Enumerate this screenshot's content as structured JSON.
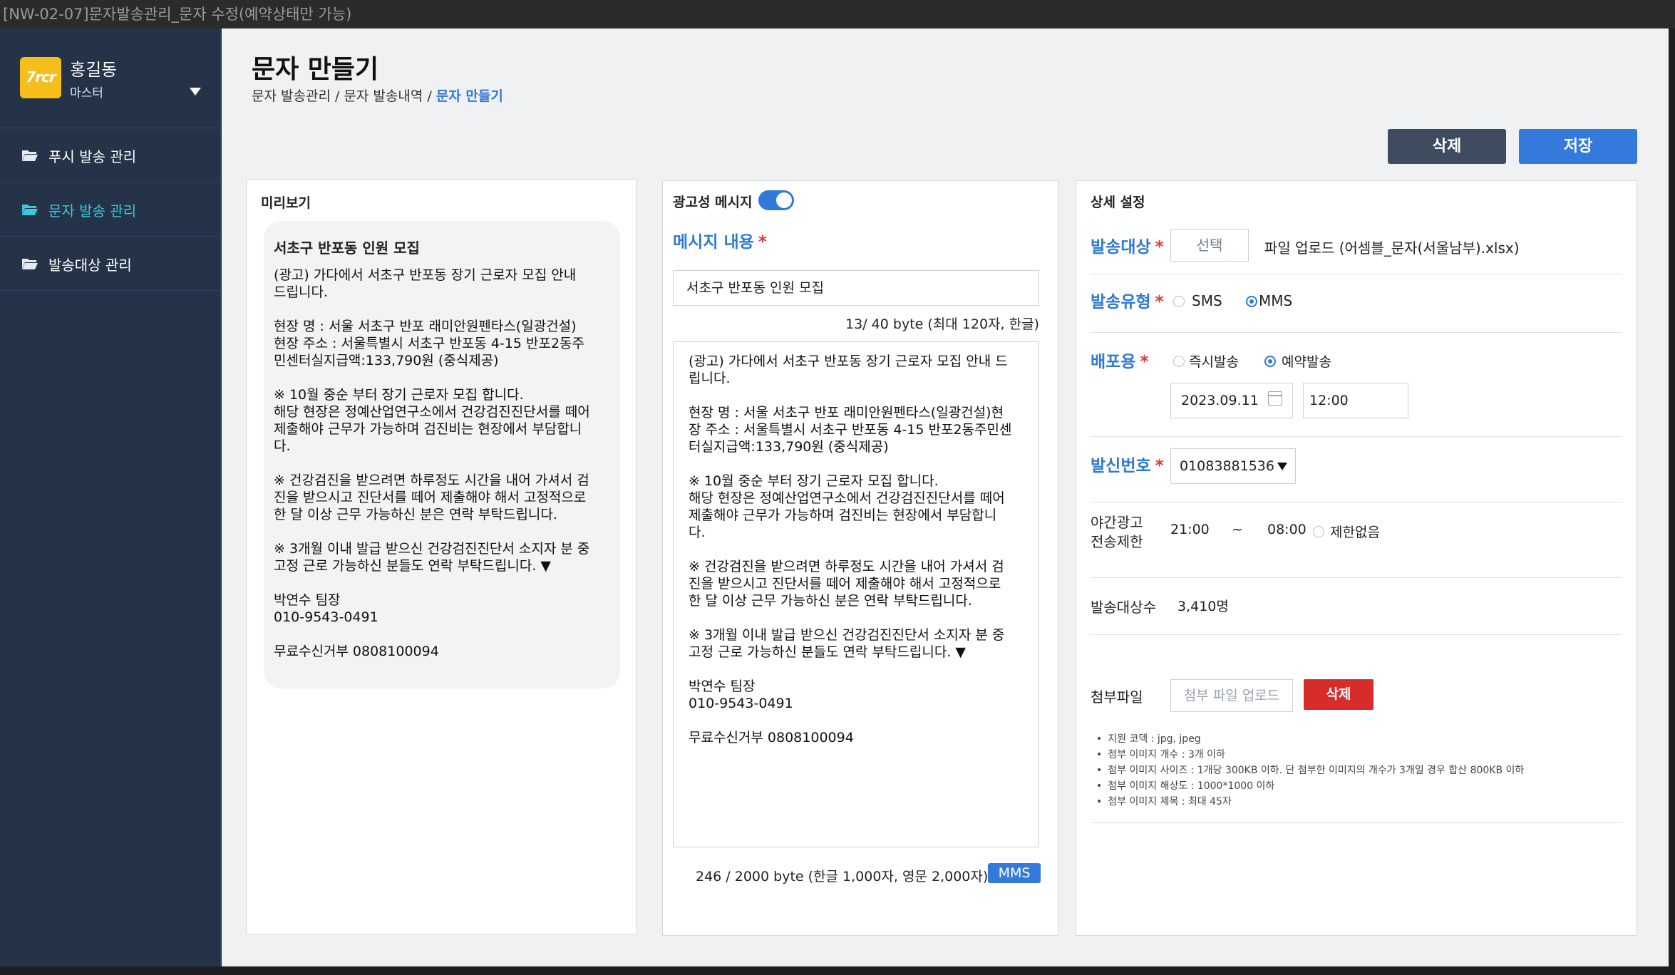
{
  "window": {
    "title": "[NW-02-07]문자발송관리_문자 수정(예약상태만 가능)"
  },
  "sidebar": {
    "logo_text": "7rcr",
    "user_name": "홍길동",
    "user_role": "마스터",
    "items": [
      {
        "label": "푸시 발송 관리",
        "active": false
      },
      {
        "label": "문자 발송 관리",
        "active": true
      },
      {
        "label": "발송대상 관리",
        "active": false
      }
    ]
  },
  "header": {
    "title": "문자 만들기",
    "breadcrumb": [
      "문자 발송관리",
      "문자 발송내역",
      "문자 만들기"
    ],
    "separator": " / "
  },
  "toolbar": {
    "delete_label": "삭제",
    "save_label": "저장"
  },
  "preview": {
    "title": "미리보기",
    "message_title": "서초구 반포동 인원 모집",
    "message_body": "(광고) 가다에서 서초구 반포동 장기 근로자 모집 안내\n드립니다.\n\n현장 명 : 서울 서초구 반포 래미안원펜타스(일광건설)\n현장 주소 : 서울특별시 서초구 반포동 4-15 반포2동주\n민센터실지급액:133,790원 (중식제공)\n\n※ 10월 중순 부터 장기 근로자 모집 합니다.\n해당 현장은 정예산업연구소에서 건강검진진단서를 떼어\n제출해야 근무가 가능하며 검진비는 현장에서 부담합니\n다.\n\n※ 건강검진을 받으려면 하루정도 시간을 내어 가셔서 검\n진을 받으시고 진단서를 떼어 제출해야 해서 고정적으로\n한 달 이상 근무 가능하신 분은 연락 부탁드립니다.\n\n※ 3개월 이내 발급 받으신 건강검진진단서 소지자 분 중\n고정 근로 가능하신 분들도 연락 부탁드립니다. ▼\n\n박연수 팀장\n010-9543-0491\n\n무료수신거부 0808100094"
  },
  "editor": {
    "ad_label": "광고성 메시지",
    "ad_enabled": true,
    "content_label": "메시지 내용",
    "required_mark": "*",
    "title_value": "서초구 반포동 인원 모집",
    "title_counter": "13/ 40 byte (최대 120자, 한글)",
    "body_value": "(광고) 가다에서 서초구 반포동 장기 근로자 모집 안내 드\n립니다.\n\n현장 명 : 서울 서초구 반포 래미안원펜타스(일광건설)현\n장 주소 : 서울특별시 서초구 반포동 4-15 반포2동주민센\n터실지급액:133,790원 (중식제공)\n\n※ 10월 중순 부터 장기 근로자 모집 합니다.\n해당 현장은 정예산업연구소에서 건강검진진단서를 떼어\n제출해야 근무가 가능하며 검진비는 현장에서 부담합니\n다.\n\n※ 건강검진을 받으려면 하루정도 시간을 내어 가셔서 검\n진을 받으시고 진단서를 떼어 제출해야 해서 고정적으로\n한 달 이상 근무 가능하신 분은 연락 부탁드립니다.\n\n※ 3개월 이내 발급 받으신 건강검진진단서 소지자 분 중\n고정 근로 가능하신 분들도 연락 부탁드립니다. ▼\n\n박연수 팀장\n010-9543-0491\n\n무료수신거부 0808100094",
    "body_counter": "246 / 2000 byte (한글 1,000자, 영문 2,000자)",
    "type_badge": "MMS"
  },
  "settings": {
    "title": "상세 설정",
    "target_label": "발송대상",
    "target_button": "선택",
    "target_file": "파일 업로드 (어셈블_문자(서울남부).xlsx)",
    "type_label": "발송유형",
    "type_options": [
      "SMS",
      "MMS"
    ],
    "type_selected": "MMS",
    "dist_label": "배포용",
    "dist_options": [
      "즉시발송",
      "예약발송"
    ],
    "dist_selected": "예약발송",
    "date_value": "2023.09.11",
    "time_value": "12:00",
    "sender_label": "발신번호",
    "sender_value": "01083881536",
    "night_label_1": "야간광고",
    "night_label_2": "전송제한",
    "night_start": "21:00",
    "night_tilde": "~",
    "night_end": "08:00",
    "night_unlimited": "제한없음",
    "count_label": "발송대상수",
    "count_value": "3,410명",
    "attach_label": "첨부파일",
    "attach_placeholder": "첨부 파일 업로드",
    "attach_delete": "삭제",
    "notes": [
      "지원 코덱 : jpg, jpeg",
      "첨부 이미지 개수 : 3개 이하",
      "첨부 이미지 사이즈 : 1개당 300KB 이하. 단 첨부한 이미지의 개수가 3개일 경우 합산 800KB 이하",
      "첨부 이미지 해상도 : 1000*1000 이하",
      "첨부 이미지 제목 : 최대 45자"
    ]
  },
  "colors": {
    "sidebar_bg": "#243347",
    "accent": "#2f79d9",
    "active_nav": "#3ec6df",
    "danger": "#d72c2c",
    "logo": "#f5be1b"
  }
}
